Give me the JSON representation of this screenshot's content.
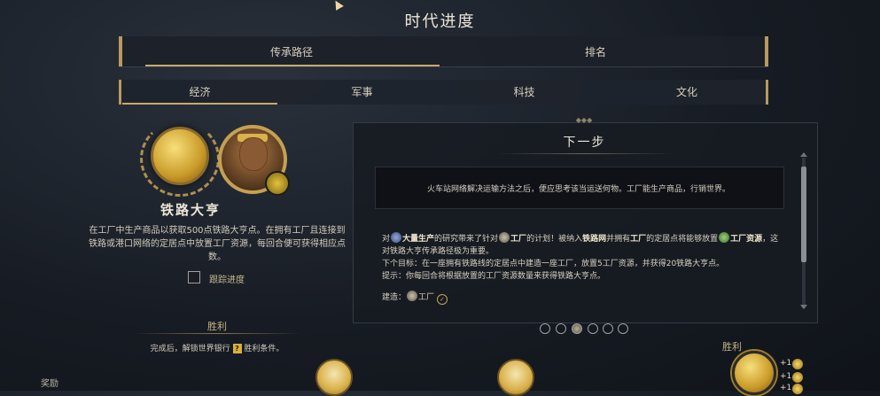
{
  "window": {
    "title": "时代进度"
  },
  "main_tabs": [
    {
      "label": "传承路径",
      "active": true
    },
    {
      "label": "排名",
      "active": false
    }
  ],
  "sub_tabs": [
    {
      "label": "经济",
      "active": true
    },
    {
      "label": "军事",
      "active": false
    },
    {
      "label": "科技",
      "active": false
    },
    {
      "label": "文化",
      "active": false
    }
  ],
  "legacy": {
    "name": "铁路大亨",
    "description": "在工厂中生产商品以获取500点铁路大亨点。在拥有工厂且连接到铁路或港口网络的定居点中放置工厂资源，每回合便可获得相应点数。",
    "track_label": "跟踪进度",
    "track_checked": false
  },
  "victory": {
    "heading": "胜利",
    "text_before": "完成后，解锁世界银行",
    "text_after": "胜利条件。",
    "icon": "?"
  },
  "rewards_label": "奖励",
  "next_step": {
    "title": "下一步",
    "info": "火车站网络解决运输方法之后，便应思考该当运送何物。工厂能生产商品，行销世界。",
    "para1": {
      "t1": "对",
      "b1": "大量生产",
      "t2": "的研究带来了针对",
      "b2": "工厂",
      "t3": "的计划！被纳入",
      "b3": "铁路网",
      "t4": "并拥有",
      "b4": "工厂",
      "t5": "的定居点将能够放置",
      "b5": "工厂资源",
      "t6": "，这对铁路大亨传承路径极为重要。"
    },
    "next_goal": "下个目标：在一座拥有铁路线的定居点中建造一座工厂，放置5工厂资源，并获得20铁路大亨点。",
    "tip": "提示：你每回合将根据放置的工厂资源数量来获得铁路大亨点。",
    "build_label": "建造：",
    "build_item": "工厂"
  },
  "pager": {
    "count": 6,
    "active_index": 2
  },
  "right_victory": {
    "heading": "胜利",
    "bonuses": [
      "+1",
      "+1",
      "+1"
    ]
  },
  "colors": {
    "gold": "#c9aa6a",
    "text": "#d9d2c3",
    "panel": "#171b22"
  },
  "icons": [
    "gold-coin-icon",
    "leader-portrait",
    "laurel-icon",
    "question-icon",
    "mass-production-icon",
    "factory-icon",
    "resource-icon",
    "checkmark-icon",
    "great-person-icon"
  ]
}
